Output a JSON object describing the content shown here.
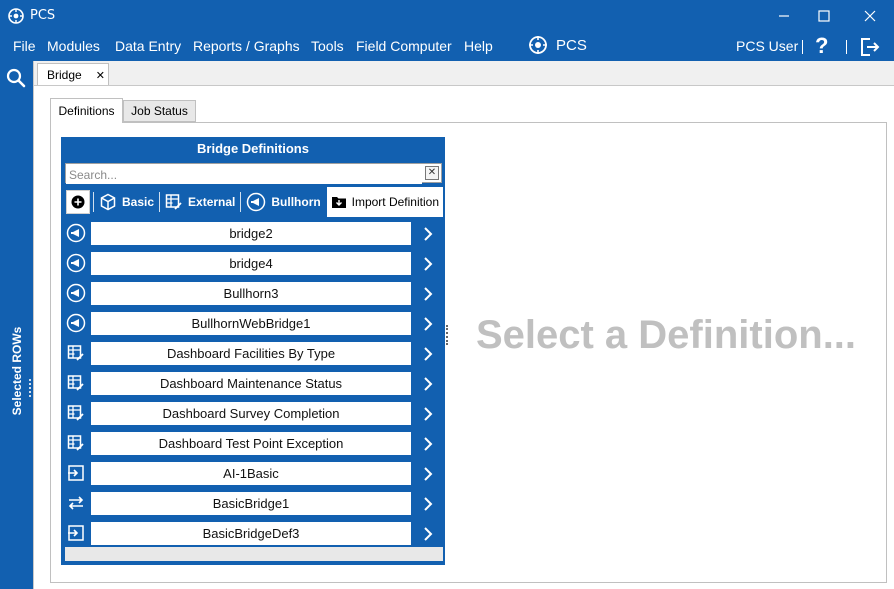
{
  "window": {
    "title": "PCS"
  },
  "menu": {
    "items": [
      "File",
      "Modules",
      "Data Entry",
      "Reports / Graphs",
      "Tools",
      "Field Computer",
      "Help"
    ],
    "brand": "PCS",
    "user": "PCS User",
    "help": "?"
  },
  "leftrail": {
    "label": "Selected ROWs"
  },
  "doc_tab": {
    "label": "Bridge",
    "close": "✕"
  },
  "sub_tabs": [
    "Definitions",
    "Job Status"
  ],
  "definitions": {
    "header": "Bridge Definitions",
    "search_placeholder": "Search...",
    "toolbar": {
      "basic": "Basic",
      "external": "External",
      "bullhorn": "Bullhorn",
      "import": "Import Definition"
    },
    "items": [
      {
        "label": "bridge2",
        "icon": "bullhorn-icon"
      },
      {
        "label": "bridge4",
        "icon": "bullhorn-icon"
      },
      {
        "label": "Bullhorn3",
        "icon": "bullhorn-icon"
      },
      {
        "label": "BullhornWebBridge1",
        "icon": "bullhorn-icon"
      },
      {
        "label": "Dashboard Facilities By Type",
        "icon": "external-icon"
      },
      {
        "label": "Dashboard Maintenance Status",
        "icon": "external-icon"
      },
      {
        "label": "Dashboard Survey Completion",
        "icon": "external-icon"
      },
      {
        "label": "Dashboard Test Point Exception",
        "icon": "external-icon"
      },
      {
        "label": "AI-1Basic",
        "icon": "import-icon"
      },
      {
        "label": "BasicBridge1",
        "icon": "transfer-icon"
      },
      {
        "label": "BasicBridgeDef3",
        "icon": "import-icon"
      }
    ]
  },
  "placeholder": "Select a Definition...",
  "colors": {
    "accent": "#1260b0",
    "placeholder_text": "#c0c0c0"
  }
}
